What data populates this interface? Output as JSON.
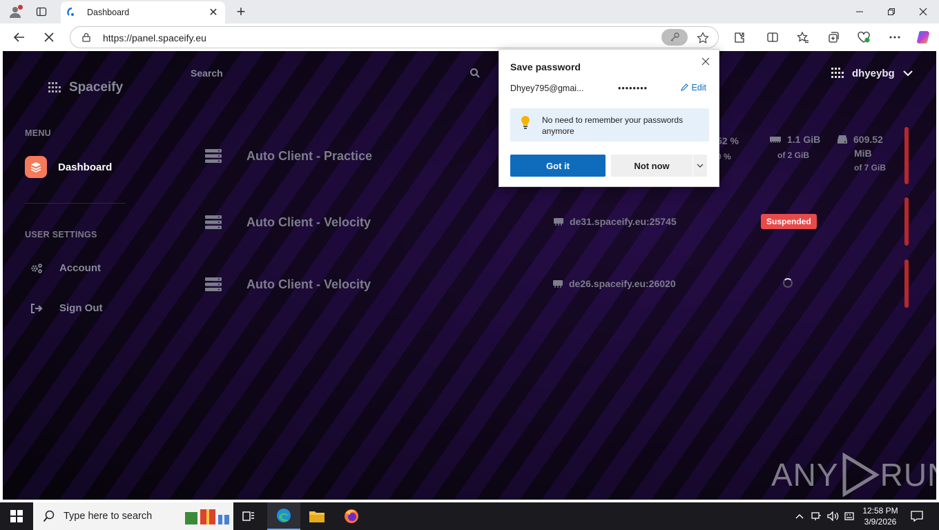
{
  "browser": {
    "tab_title": "Dashboard",
    "url": "https://panel.spaceify.eu",
    "new_tab_symbol": "+",
    "close_tab_symbol": "✕"
  },
  "popup": {
    "title": "Save password",
    "username": "Dhyey795@gmai...",
    "password_mask": "••••••••",
    "edit_label": "Edit",
    "info_text": "No need to remember your passwords anymore",
    "got_it": "Got it",
    "not_now": "Not now"
  },
  "sidebar": {
    "brand": "Spaceify",
    "menu_label": "MENU",
    "dashboard": "Dashboard",
    "user_settings_label": "USER SETTINGS",
    "account": "Account",
    "sign_out": "Sign Out"
  },
  "header": {
    "search_placeholder": "Search",
    "username": "dhyeybg"
  },
  "servers": [
    {
      "name": "Auto Client - Practice",
      "cpu_partial": "52 %",
      "cpu_partial_2": "0 %",
      "memory": "1.1 GiB",
      "memory_total": "of 2 GiB",
      "disk": "609.52",
      "disk_unit": "MiB",
      "disk_total": "of 7 GiB"
    },
    {
      "name": "Auto Client - Velocity",
      "address": "de31.spaceify.eu:25745",
      "status": "Suspended"
    },
    {
      "name": "Auto Client - Velocity",
      "address": "de26.spaceify.eu:26020"
    }
  ],
  "watermark": {
    "left": "ANY",
    "right": "RUN"
  },
  "taskbar": {
    "search_text": "Type here to search",
    "time": "12:58 PM",
    "date": "3/9/2026"
  },
  "colors": {
    "accent_blue": "#0f6cbd",
    "suspended_red": "#e84a4a",
    "dashboard_icon": "#f47a5a"
  }
}
